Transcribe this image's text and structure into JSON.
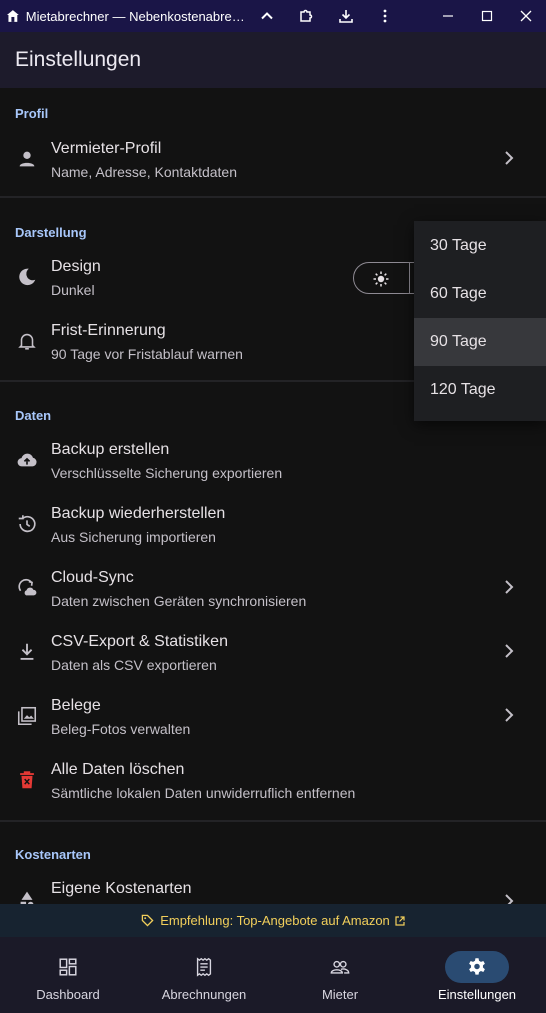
{
  "window": {
    "title": "Mietabrechner — Nebenkostenabrechnung"
  },
  "appbar": {
    "title": "Einstellungen"
  },
  "sections": {
    "profil": "Profil",
    "darstellung": "Darstellung",
    "daten": "Daten",
    "kostenarten": "Kostenarten"
  },
  "rows": {
    "vermieter": {
      "title": "Vermieter-Profil",
      "subtitle": "Name, Adresse, Kontaktdaten"
    },
    "design": {
      "title": "Design",
      "subtitle": "Dunkel"
    },
    "frist": {
      "title": "Frist-Erinnerung",
      "subtitle": "90 Tage vor Fristablauf warnen"
    },
    "backup": {
      "title": "Backup erstellen",
      "subtitle": "Verschlüsselte Sicherung exportieren"
    },
    "restore": {
      "title": "Backup wiederherstellen",
      "subtitle": "Aus Sicherung importieren"
    },
    "cloud": {
      "title": "Cloud-Sync",
      "subtitle": "Daten zwischen Geräten synchronisieren"
    },
    "csv": {
      "title": "CSV-Export & Statistiken",
      "subtitle": "Daten als CSV exportieren"
    },
    "belege": {
      "title": "Belege",
      "subtitle": "Beleg-Fotos verwalten"
    },
    "delete": {
      "title": "Alle Daten löschen",
      "subtitle": "Sämtliche lokalen Daten unwiderruflich entfernen"
    },
    "kostenarten": {
      "title": "Eigene Kostenarten"
    }
  },
  "dropdown": {
    "options": [
      "30 Tage",
      "60 Tage",
      "90 Tage",
      "120 Tage"
    ],
    "selected": "90 Tage"
  },
  "banner": {
    "text": "Empfehlung: Top-Angebote auf Amazon"
  },
  "bottom_nav": {
    "items": [
      {
        "label": "Dashboard",
        "icon": "dashboard-icon"
      },
      {
        "label": "Abrechnungen",
        "icon": "receipt-icon"
      },
      {
        "label": "Mieter",
        "icon": "people-icon"
      },
      {
        "label": "Einstellungen",
        "icon": "gear-icon"
      }
    ],
    "active": "Einstellungen"
  },
  "colors": {
    "accent": "#a8c7fa",
    "danger": "#e53935",
    "banner_text": "#f2cf5b",
    "nav_active": "#2a4b72"
  }
}
